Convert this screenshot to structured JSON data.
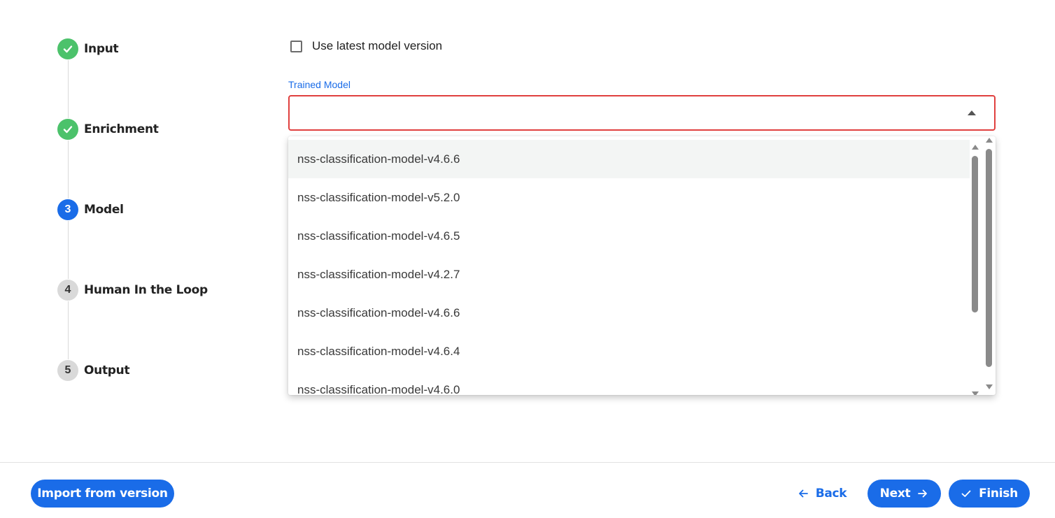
{
  "stepper": {
    "steps": [
      {
        "number": "",
        "label": "Input",
        "state": "done",
        "icon": "check-icon"
      },
      {
        "number": "",
        "label": "Enrichment",
        "state": "done",
        "icon": "check-icon"
      },
      {
        "number": "3",
        "label": "Model",
        "state": "active"
      },
      {
        "number": "4",
        "label": "Human In the Loop",
        "state": "pending"
      },
      {
        "number": "5",
        "label": "Output",
        "state": "pending"
      }
    ]
  },
  "form": {
    "use_latest_label": "Use latest model version",
    "use_latest_checked": false,
    "trained_model_label": "Trained Model",
    "trained_model_value": "",
    "dropdown_open": true,
    "options": [
      "nss-classification-model-v4.6.6",
      "nss-classification-model-v5.2.0",
      "nss-classification-model-v4.6.5",
      "nss-classification-model-v4.2.7",
      "nss-classification-model-v4.6.6",
      "nss-classification-model-v4.6.4",
      "nss-classification-model-v4.6.0"
    ],
    "highlighted_option_index": 0
  },
  "footer": {
    "import_label": "Import from version",
    "back_label": "Back",
    "next_label": "Next",
    "finish_label": "Finish"
  },
  "colors": {
    "primary": "#1a6ce8",
    "success": "#4cc26b",
    "error_border": "#e0403f",
    "pending": "#d9d9d9"
  }
}
